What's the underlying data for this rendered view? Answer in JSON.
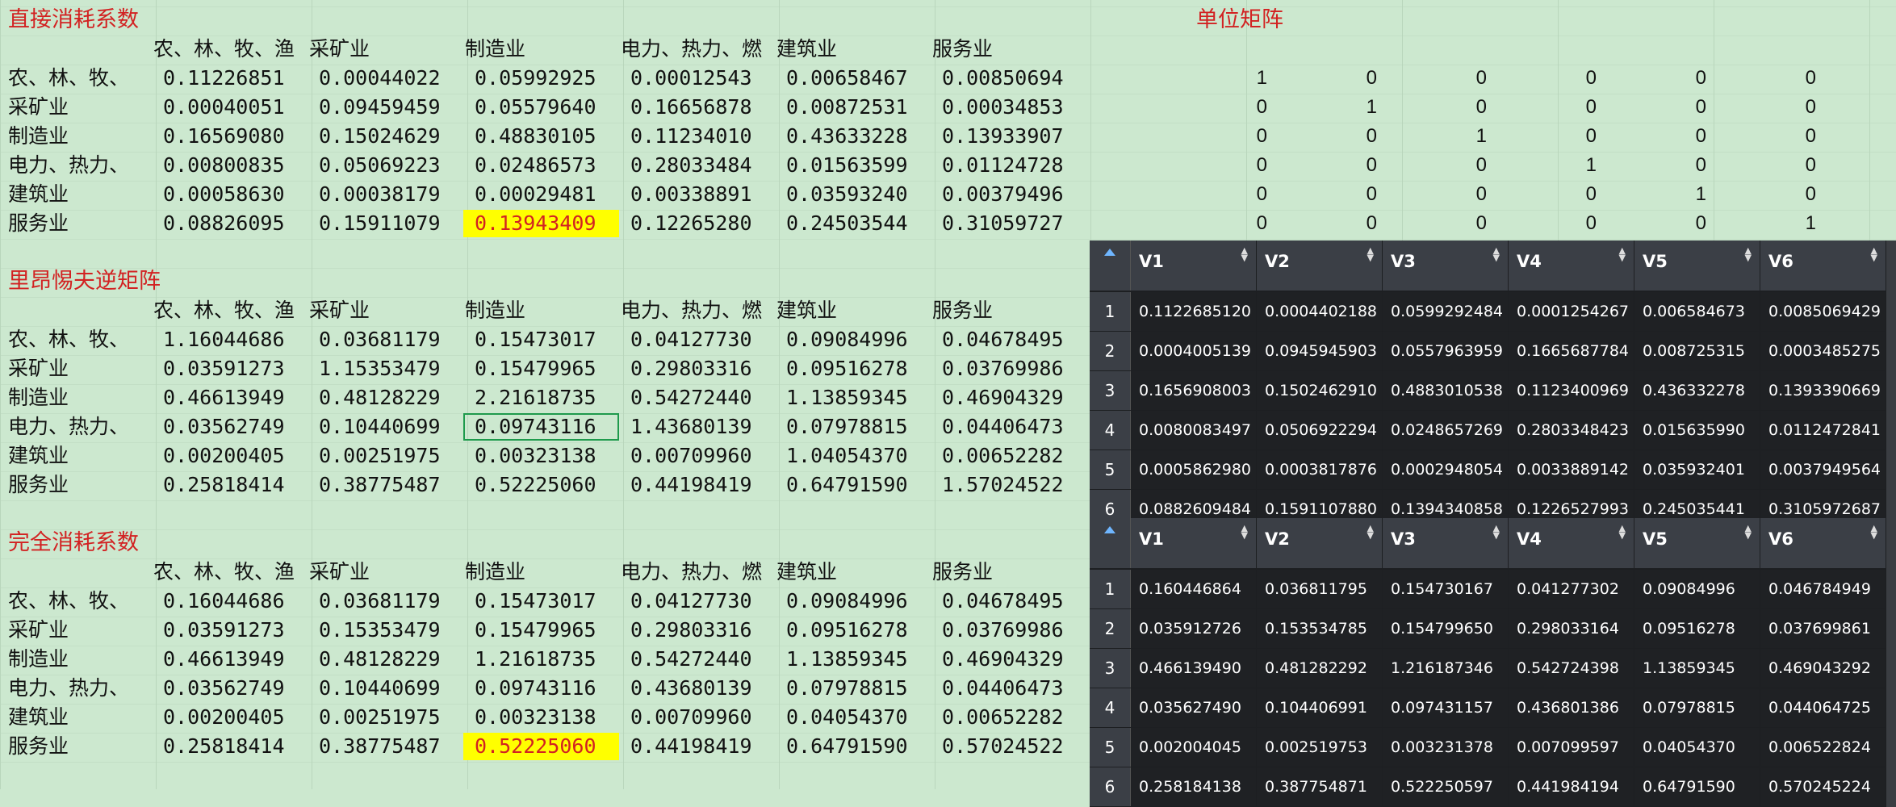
{
  "sheet": {
    "direct": {
      "title": "直接消耗系数",
      "headers": [
        "农、林、牧、渔",
        "采矿业",
        "制造业",
        "电力、热力、燃",
        "建筑业",
        "服务业"
      ],
      "rows": [
        {
          "label": "农、林、牧、",
          "values": [
            "0.11226851",
            "0.00044022",
            "0.05992925",
            "0.00012543",
            "0.00658467",
            "0.00850694"
          ]
        },
        {
          "label": "采矿业",
          "values": [
            "0.00040051",
            "0.09459459",
            "0.05579640",
            "0.16656878",
            "0.00872531",
            "0.00034853"
          ]
        },
        {
          "label": "制造业",
          "values": [
            "0.16569080",
            "0.15024629",
            "0.48830105",
            "0.11234010",
            "0.43633228",
            "0.13933907"
          ]
        },
        {
          "label": "电力、热力、",
          "values": [
            "0.00800835",
            "0.05069223",
            "0.02486573",
            "0.28033484",
            "0.01563599",
            "0.01124728"
          ]
        },
        {
          "label": "建筑业",
          "values": [
            "0.00058630",
            "0.00038179",
            "0.00029481",
            "0.00338891",
            "0.03593240",
            "0.00379496"
          ]
        },
        {
          "label": "服务业",
          "values": [
            "0.08826095",
            "0.15911079",
            "0.13943409",
            "0.12265280",
            "0.24503544",
            "0.31059727"
          ]
        }
      ]
    },
    "leontief": {
      "title": "里昂惕夫逆矩阵",
      "headers": [
        "农、林、牧、渔",
        "采矿业",
        "制造业",
        "电力、热力、燃",
        "建筑业",
        "服务业"
      ],
      "rows": [
        {
          "label": "农、林、牧、",
          "values": [
            "1.16044686",
            "0.03681179",
            "0.15473017",
            "0.04127730",
            "0.09084996",
            "0.04678495"
          ]
        },
        {
          "label": "采矿业",
          "values": [
            "0.03591273",
            "1.15353479",
            "0.15479965",
            "0.29803316",
            "0.09516278",
            "0.03769986"
          ]
        },
        {
          "label": "制造业",
          "values": [
            "0.46613949",
            "0.48128229",
            "2.21618735",
            "0.54272440",
            "1.13859345",
            "0.46904329"
          ]
        },
        {
          "label": "电力、热力、",
          "values": [
            "0.03562749",
            "0.10440699",
            "0.09743116",
            "1.43680139",
            "0.07978815",
            "0.04406473"
          ]
        },
        {
          "label": "建筑业",
          "values": [
            "0.00200405",
            "0.00251975",
            "0.00323138",
            "0.00709960",
            "1.04054370",
            "0.00652282"
          ]
        },
        {
          "label": "服务业",
          "values": [
            "0.25818414",
            "0.38775487",
            "0.52225060",
            "0.44198419",
            "0.64791590",
            "1.57024522"
          ]
        }
      ]
    },
    "total": {
      "title": "完全消耗系数",
      "headers": [
        "农、林、牧、渔",
        "采矿业",
        "制造业",
        "电力、热力、燃",
        "建筑业",
        "服务业"
      ],
      "rows": [
        {
          "label": "农、林、牧、",
          "values": [
            "0.16044686",
            "0.03681179",
            "0.15473017",
            "0.04127730",
            "0.09084996",
            "0.04678495"
          ]
        },
        {
          "label": "采矿业",
          "values": [
            "0.03591273",
            "0.15353479",
            "0.15479965",
            "0.29803316",
            "0.09516278",
            "0.03769986"
          ]
        },
        {
          "label": "制造业",
          "values": [
            "0.46613949",
            "0.48128229",
            "1.21618735",
            "0.54272440",
            "1.13859345",
            "0.46904329"
          ]
        },
        {
          "label": "电力、热力、",
          "values": [
            "0.03562749",
            "0.10440699",
            "0.09743116",
            "0.43680139",
            "0.07978815",
            "0.04406473"
          ]
        },
        {
          "label": "建筑业",
          "values": [
            "0.00200405",
            "0.00251975",
            "0.00323138",
            "0.00709960",
            "0.04054370",
            "0.00652282"
          ]
        },
        {
          "label": "服务业",
          "values": [
            "0.25818414",
            "0.38775487",
            "0.52225060",
            "0.44198419",
            "0.64791590",
            "0.57024522"
          ]
        }
      ]
    },
    "identity": {
      "title": "单位矩阵",
      "rows": [
        [
          "1",
          "0",
          "0",
          "0",
          "0",
          "0"
        ],
        [
          "0",
          "1",
          "0",
          "0",
          "0",
          "0"
        ],
        [
          "0",
          "0",
          "1",
          "0",
          "0",
          "0"
        ],
        [
          "0",
          "0",
          "0",
          "1",
          "0",
          "0"
        ],
        [
          "0",
          "0",
          "0",
          "0",
          "1",
          "0"
        ],
        [
          "0",
          "0",
          "0",
          "0",
          "0",
          "1"
        ]
      ]
    }
  },
  "viewer1": {
    "columns": [
      "V1",
      "V2",
      "V3",
      "V4",
      "V5",
      "V6"
    ],
    "rows": [
      {
        "idx": "1",
        "values": [
          "0.1122685120",
          "0.0004402188",
          "0.0599292484",
          "0.0001254267",
          "0.006584673",
          "0.0085069429"
        ]
      },
      {
        "idx": "2",
        "values": [
          "0.0004005139",
          "0.0945945903",
          "0.0557963959",
          "0.1665687784",
          "0.008725315",
          "0.0003485275"
        ]
      },
      {
        "idx": "3",
        "values": [
          "0.1656908003",
          "0.1502462910",
          "0.4883010538",
          "0.1123400969",
          "0.436332278",
          "0.1393390669"
        ]
      },
      {
        "idx": "4",
        "values": [
          "0.0080083497",
          "0.0506922294",
          "0.0248657269",
          "0.2803348423",
          "0.015635990",
          "0.0112472841"
        ]
      },
      {
        "idx": "5",
        "values": [
          "0.0005862980",
          "0.0003817876",
          "0.0002948054",
          "0.0033889142",
          "0.035932401",
          "0.0037949564"
        ]
      },
      {
        "idx": "6",
        "values": [
          "0.0882609484",
          "0.1591107880",
          "0.1394340858",
          "0.1226527993",
          "0.245035441",
          "0.3105972687"
        ]
      }
    ]
  },
  "viewer2": {
    "columns": [
      "V1",
      "V2",
      "V3",
      "V4",
      "V5",
      "V6"
    ],
    "rows": [
      {
        "idx": "1",
        "values": [
          "0.160446864",
          "0.036811795",
          "0.154730167",
          "0.041277302",
          "0.09084996",
          "0.046784949"
        ]
      },
      {
        "idx": "2",
        "values": [
          "0.035912726",
          "0.153534785",
          "0.154799650",
          "0.298033164",
          "0.09516278",
          "0.037699861"
        ]
      },
      {
        "idx": "3",
        "values": [
          "0.466139490",
          "0.481282292",
          "1.216187346",
          "0.542724398",
          "1.13859345",
          "0.469043292"
        ]
      },
      {
        "idx": "4",
        "values": [
          "0.035627490",
          "0.104406991",
          "0.097431157",
          "0.436801386",
          "0.07978815",
          "0.044064725"
        ]
      },
      {
        "idx": "5",
        "values": [
          "0.002004045",
          "0.002519753",
          "0.003231378",
          "0.007099597",
          "0.04054370",
          "0.006522824"
        ]
      },
      {
        "idx": "6",
        "values": [
          "0.258184138",
          "0.387754871",
          "0.522250597",
          "0.441984194",
          "0.64791590",
          "0.570245224"
        ]
      }
    ]
  },
  "colors": {
    "sheet_bg": "#cce8cf",
    "title_red": "#d22222",
    "highlight_yellow": "#ffff00",
    "selection_green": "#1e9a4c",
    "viewer_bg": "#1f2124",
    "viewer_header": "#3b3f46",
    "sort_icon_blue": "#6fb6ff"
  }
}
